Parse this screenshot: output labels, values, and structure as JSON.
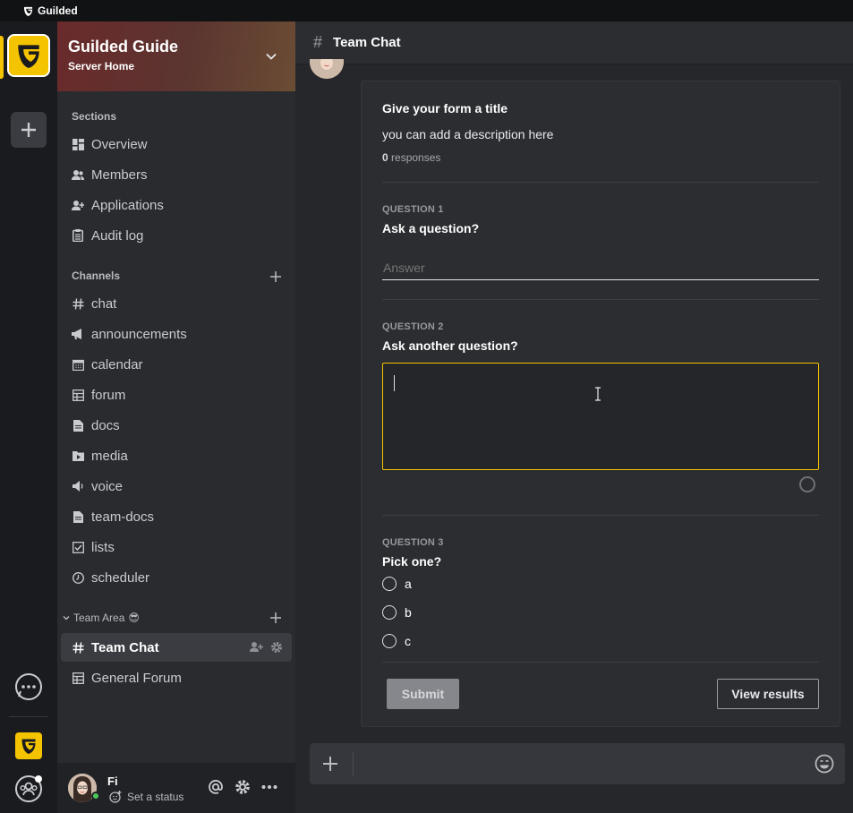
{
  "app": {
    "title": "Guilded"
  },
  "server": {
    "name": "Guilded Guide",
    "subtitle": "Server Home"
  },
  "sections": {
    "label": "Sections",
    "items": [
      {
        "label": "Overview",
        "icon": "dashboard-icon"
      },
      {
        "label": "Members",
        "icon": "members-icon"
      },
      {
        "label": "Applications",
        "icon": "add-user-icon"
      },
      {
        "label": "Audit log",
        "icon": "clipboard-icon"
      }
    ]
  },
  "channels": {
    "label": "Channels",
    "items": [
      {
        "label": "chat",
        "icon": "hash-icon"
      },
      {
        "label": "announcements",
        "icon": "megaphone-icon"
      },
      {
        "label": "calendar",
        "icon": "calendar-icon"
      },
      {
        "label": "forum",
        "icon": "forum-icon"
      },
      {
        "label": "docs",
        "icon": "doc-icon"
      },
      {
        "label": "media",
        "icon": "media-icon"
      },
      {
        "label": "voice",
        "icon": "speaker-icon"
      },
      {
        "label": "team-docs",
        "icon": "doc-icon"
      },
      {
        "label": "lists",
        "icon": "checkbox-icon"
      },
      {
        "label": "scheduler",
        "icon": "clock-icon"
      }
    ]
  },
  "team_area": {
    "label": "Team Area",
    "emoji": "😎",
    "items": [
      {
        "label": "Team Chat",
        "icon": "hash-icon",
        "active": true
      },
      {
        "label": "General Forum",
        "icon": "forum-icon"
      }
    ]
  },
  "user": {
    "name": "Fi",
    "status": "Set a status"
  },
  "channel_header": {
    "title": "Team Chat"
  },
  "form": {
    "title": "Give your form a title",
    "description": "you can add a description here",
    "responses_count": "0",
    "responses_label": "responses",
    "questions": [
      {
        "label": "QUESTION 1",
        "text": "Ask a question?",
        "answer_placeholder": "Answer"
      },
      {
        "label": "QUESTION 2",
        "text": "Ask another question?"
      },
      {
        "label": "QUESTION 3",
        "text": "Pick one?",
        "options": [
          "a",
          "b",
          "c"
        ]
      }
    ],
    "submit_label": "Submit",
    "results_label": "View results"
  },
  "colors": {
    "accent": "#f5c400",
    "online": "#4ac95c"
  }
}
